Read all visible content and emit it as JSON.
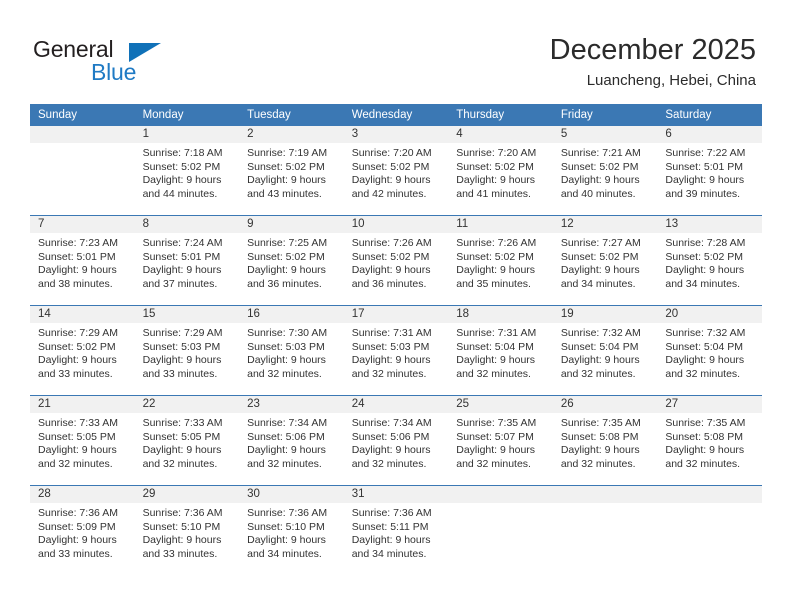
{
  "brand": {
    "name_part1": "General",
    "name_part2": "Blue",
    "triangle_color": "#1071b8",
    "blue_color": "#1f7ac4"
  },
  "header": {
    "title": "December 2025",
    "subtitle": "Luancheng, Hebei, China"
  },
  "theme": {
    "header_blue": "#3b78b4",
    "daynum_band": "#f1f1f1",
    "text": "#333333"
  },
  "weekday_headers": [
    "Sunday",
    "Monday",
    "Tuesday",
    "Wednesday",
    "Thursday",
    "Friday",
    "Saturday"
  ],
  "weeks": [
    [
      {
        "day": "",
        "sunrise": "",
        "sunset": "",
        "daylight": "",
        "daylight2": "",
        "empty": true
      },
      {
        "day": "1",
        "sunrise": "Sunrise: 7:18 AM",
        "sunset": "Sunset: 5:02 PM",
        "daylight": "Daylight: 9 hours",
        "daylight2": "and 44 minutes.",
        "empty": false
      },
      {
        "day": "2",
        "sunrise": "Sunrise: 7:19 AM",
        "sunset": "Sunset: 5:02 PM",
        "daylight": "Daylight: 9 hours",
        "daylight2": "and 43 minutes.",
        "empty": false
      },
      {
        "day": "3",
        "sunrise": "Sunrise: 7:20 AM",
        "sunset": "Sunset: 5:02 PM",
        "daylight": "Daylight: 9 hours",
        "daylight2": "and 42 minutes.",
        "empty": false
      },
      {
        "day": "4",
        "sunrise": "Sunrise: 7:20 AM",
        "sunset": "Sunset: 5:02 PM",
        "daylight": "Daylight: 9 hours",
        "daylight2": "and 41 minutes.",
        "empty": false
      },
      {
        "day": "5",
        "sunrise": "Sunrise: 7:21 AM",
        "sunset": "Sunset: 5:02 PM",
        "daylight": "Daylight: 9 hours",
        "daylight2": "and 40 minutes.",
        "empty": false
      },
      {
        "day": "6",
        "sunrise": "Sunrise: 7:22 AM",
        "sunset": "Sunset: 5:01 PM",
        "daylight": "Daylight: 9 hours",
        "daylight2": "and 39 minutes.",
        "empty": false
      }
    ],
    [
      {
        "day": "7",
        "sunrise": "Sunrise: 7:23 AM",
        "sunset": "Sunset: 5:01 PM",
        "daylight": "Daylight: 9 hours",
        "daylight2": "and 38 minutes.",
        "empty": false
      },
      {
        "day": "8",
        "sunrise": "Sunrise: 7:24 AM",
        "sunset": "Sunset: 5:01 PM",
        "daylight": "Daylight: 9 hours",
        "daylight2": "and 37 minutes.",
        "empty": false
      },
      {
        "day": "9",
        "sunrise": "Sunrise: 7:25 AM",
        "sunset": "Sunset: 5:02 PM",
        "daylight": "Daylight: 9 hours",
        "daylight2": "and 36 minutes.",
        "empty": false
      },
      {
        "day": "10",
        "sunrise": "Sunrise: 7:26 AM",
        "sunset": "Sunset: 5:02 PM",
        "daylight": "Daylight: 9 hours",
        "daylight2": "and 36 minutes.",
        "empty": false
      },
      {
        "day": "11",
        "sunrise": "Sunrise: 7:26 AM",
        "sunset": "Sunset: 5:02 PM",
        "daylight": "Daylight: 9 hours",
        "daylight2": "and 35 minutes.",
        "empty": false
      },
      {
        "day": "12",
        "sunrise": "Sunrise: 7:27 AM",
        "sunset": "Sunset: 5:02 PM",
        "daylight": "Daylight: 9 hours",
        "daylight2": "and 34 minutes.",
        "empty": false
      },
      {
        "day": "13",
        "sunrise": "Sunrise: 7:28 AM",
        "sunset": "Sunset: 5:02 PM",
        "daylight": "Daylight: 9 hours",
        "daylight2": "and 34 minutes.",
        "empty": false
      }
    ],
    [
      {
        "day": "14",
        "sunrise": "Sunrise: 7:29 AM",
        "sunset": "Sunset: 5:02 PM",
        "daylight": "Daylight: 9 hours",
        "daylight2": "and 33 minutes.",
        "empty": false
      },
      {
        "day": "15",
        "sunrise": "Sunrise: 7:29 AM",
        "sunset": "Sunset: 5:03 PM",
        "daylight": "Daylight: 9 hours",
        "daylight2": "and 33 minutes.",
        "empty": false
      },
      {
        "day": "16",
        "sunrise": "Sunrise: 7:30 AM",
        "sunset": "Sunset: 5:03 PM",
        "daylight": "Daylight: 9 hours",
        "daylight2": "and 32 minutes.",
        "empty": false
      },
      {
        "day": "17",
        "sunrise": "Sunrise: 7:31 AM",
        "sunset": "Sunset: 5:03 PM",
        "daylight": "Daylight: 9 hours",
        "daylight2": "and 32 minutes.",
        "empty": false
      },
      {
        "day": "18",
        "sunrise": "Sunrise: 7:31 AM",
        "sunset": "Sunset: 5:04 PM",
        "daylight": "Daylight: 9 hours",
        "daylight2": "and 32 minutes.",
        "empty": false
      },
      {
        "day": "19",
        "sunrise": "Sunrise: 7:32 AM",
        "sunset": "Sunset: 5:04 PM",
        "daylight": "Daylight: 9 hours",
        "daylight2": "and 32 minutes.",
        "empty": false
      },
      {
        "day": "20",
        "sunrise": "Sunrise: 7:32 AM",
        "sunset": "Sunset: 5:04 PM",
        "daylight": "Daylight: 9 hours",
        "daylight2": "and 32 minutes.",
        "empty": false
      }
    ],
    [
      {
        "day": "21",
        "sunrise": "Sunrise: 7:33 AM",
        "sunset": "Sunset: 5:05 PM",
        "daylight": "Daylight: 9 hours",
        "daylight2": "and 32 minutes.",
        "empty": false
      },
      {
        "day": "22",
        "sunrise": "Sunrise: 7:33 AM",
        "sunset": "Sunset: 5:05 PM",
        "daylight": "Daylight: 9 hours",
        "daylight2": "and 32 minutes.",
        "empty": false
      },
      {
        "day": "23",
        "sunrise": "Sunrise: 7:34 AM",
        "sunset": "Sunset: 5:06 PM",
        "daylight": "Daylight: 9 hours",
        "daylight2": "and 32 minutes.",
        "empty": false
      },
      {
        "day": "24",
        "sunrise": "Sunrise: 7:34 AM",
        "sunset": "Sunset: 5:06 PM",
        "daylight": "Daylight: 9 hours",
        "daylight2": "and 32 minutes.",
        "empty": false
      },
      {
        "day": "25",
        "sunrise": "Sunrise: 7:35 AM",
        "sunset": "Sunset: 5:07 PM",
        "daylight": "Daylight: 9 hours",
        "daylight2": "and 32 minutes.",
        "empty": false
      },
      {
        "day": "26",
        "sunrise": "Sunrise: 7:35 AM",
        "sunset": "Sunset: 5:08 PM",
        "daylight": "Daylight: 9 hours",
        "daylight2": "and 32 minutes.",
        "empty": false
      },
      {
        "day": "27",
        "sunrise": "Sunrise: 7:35 AM",
        "sunset": "Sunset: 5:08 PM",
        "daylight": "Daylight: 9 hours",
        "daylight2": "and 32 minutes.",
        "empty": false
      }
    ],
    [
      {
        "day": "28",
        "sunrise": "Sunrise: 7:36 AM",
        "sunset": "Sunset: 5:09 PM",
        "daylight": "Daylight: 9 hours",
        "daylight2": "and 33 minutes.",
        "empty": false
      },
      {
        "day": "29",
        "sunrise": "Sunrise: 7:36 AM",
        "sunset": "Sunset: 5:10 PM",
        "daylight": "Daylight: 9 hours",
        "daylight2": "and 33 minutes.",
        "empty": false
      },
      {
        "day": "30",
        "sunrise": "Sunrise: 7:36 AM",
        "sunset": "Sunset: 5:10 PM",
        "daylight": "Daylight: 9 hours",
        "daylight2": "and 34 minutes.",
        "empty": false
      },
      {
        "day": "31",
        "sunrise": "Sunrise: 7:36 AM",
        "sunset": "Sunset: 5:11 PM",
        "daylight": "Daylight: 9 hours",
        "daylight2": "and 34 minutes.",
        "empty": false
      },
      {
        "day": "",
        "sunrise": "",
        "sunset": "",
        "daylight": "",
        "daylight2": "",
        "empty": true
      },
      {
        "day": "",
        "sunrise": "",
        "sunset": "",
        "daylight": "",
        "daylight2": "",
        "empty": true
      },
      {
        "day": "",
        "sunrise": "",
        "sunset": "",
        "daylight": "",
        "daylight2": "",
        "empty": true
      }
    ]
  ]
}
